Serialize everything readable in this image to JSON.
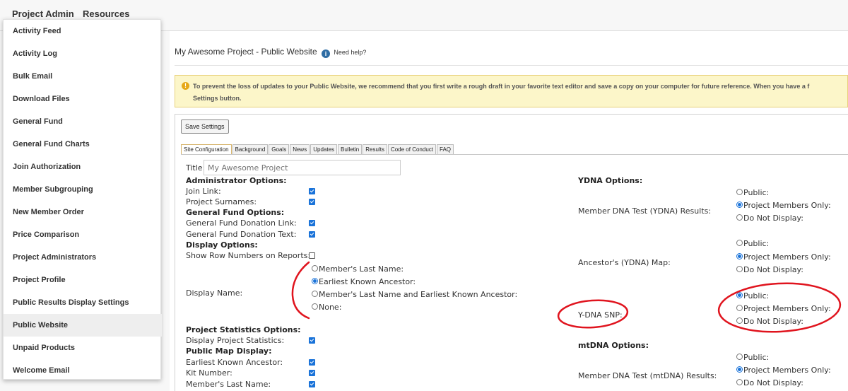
{
  "topnav": {
    "project_admin": "Project Admin",
    "resources": "Resources"
  },
  "menu": {
    "items": [
      "Activity Feed",
      "Activity Log",
      "Bulk Email",
      "Download Files",
      "General Fund",
      "General Fund Charts",
      "Join Authorization",
      "Member Subgrouping",
      "New Member Order",
      "Price Comparison",
      "Project Administrators",
      "Project Profile",
      "Public Results Display Settings",
      "Public Website",
      "Unpaid Products",
      "Welcome Email"
    ],
    "active": "Public Website"
  },
  "page": {
    "title": "My Awesome Project - Public Website",
    "help_icon": "i",
    "help_link": "Need help?"
  },
  "warning": {
    "icon": "!",
    "line1": "To prevent the loss of updates to your Public Website, we recommend that you first write a rough draft in your favorite text editor and save a copy on your computer for future reference. When you have a f",
    "line2": "Settings button."
  },
  "save_label": "Save Settings",
  "tabs": [
    "Site Configuration",
    "Background",
    "Goals",
    "News",
    "Updates",
    "Bulletin",
    "Results",
    "Code of Conduct",
    "FAQ"
  ],
  "active_tab": "Site Configuration",
  "form": {
    "title_label": "Title:",
    "title_placeholder": "My Awesome Project",
    "admin_header": "Administrator Options:",
    "join_link": "Join Link:",
    "project_surnames": "Project Surnames:",
    "fund_header": "General Fund Options:",
    "fund_link": "General Fund Donation Link:",
    "fund_text": "General Fund Donation Text:",
    "display_header": "Display Options:",
    "row_numbers": "Show Row Numbers on Reports:",
    "display_name_label": "Display Name:",
    "display_name_options": [
      "Member's Last Name:",
      "Earliest Known Ancestor:",
      "Member's Last Name and Earliest Known Ancestor:",
      "None:"
    ],
    "display_name_selected": "Earliest Known Ancestor:",
    "stats_header": "Project Statistics Options:",
    "display_stats": "Display Project Statistics:",
    "map_header": "Public Map Display:",
    "map_eka": "Earliest Known Ancestor:",
    "map_kit": "Kit Number:",
    "map_last": "Member's Last Name:"
  },
  "ydna": {
    "header": "YDNA Options:",
    "rows": [
      {
        "label": "Member DNA Test (YDNA) Results:",
        "options": [
          "Public:",
          "Project Members Only:",
          "Do Not Display:"
        ],
        "selected": "Project Members Only:"
      },
      {
        "label": "Ancestor's (YDNA) Map:",
        "options": [
          "Public:",
          "Project Members Only:",
          "Do Not Display:"
        ],
        "selected": "Project Members Only:"
      },
      {
        "label": "Y-DNA SNP:",
        "options": [
          "Public:",
          "Project Members Only:",
          "Do Not Display:"
        ],
        "selected": "Public:"
      }
    ]
  },
  "mtdna": {
    "header": "mtDNA Options:",
    "rows": [
      {
        "label": "Member DNA Test (mtDNA) Results:",
        "options": [
          "Public:",
          "Project Members Only:",
          "Do Not Display:"
        ],
        "selected": "Project Members Only:"
      }
    ]
  },
  "colors": {
    "accent": "#1a73d9",
    "annotation": "#e0141e",
    "warning_bg": "#fcf6c9",
    "menu_active_bg": "#eeeeee"
  }
}
